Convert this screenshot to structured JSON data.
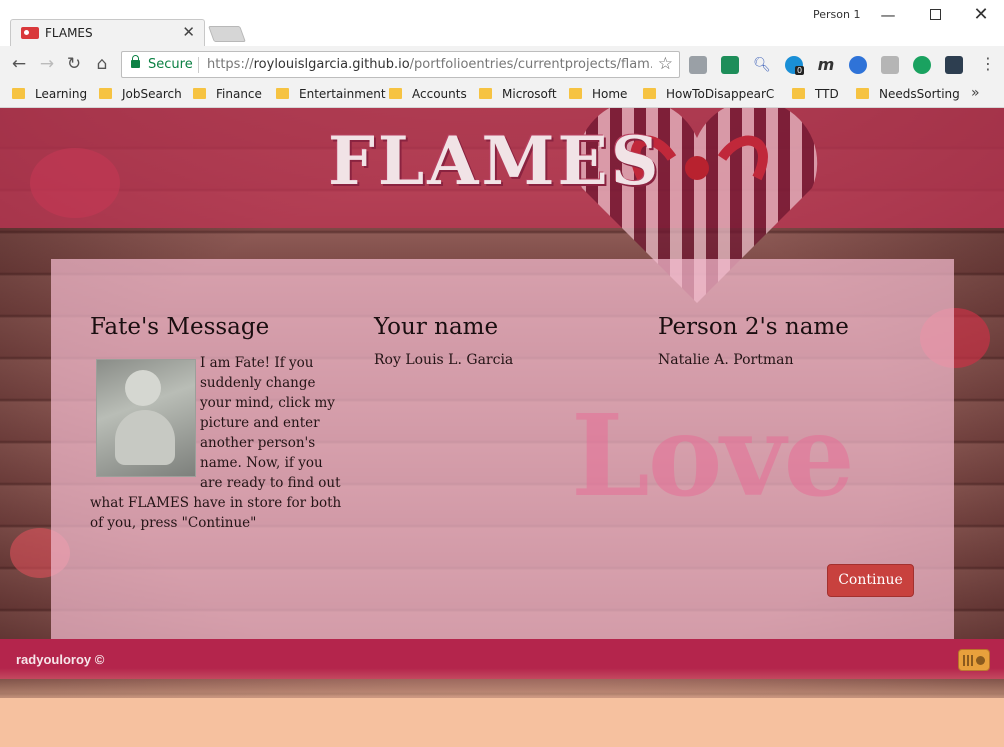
{
  "browser": {
    "tab_title": "FLAMES",
    "profile_label": "Person 1",
    "secure_label": "Secure",
    "url_scheme": "https://",
    "url_host": "roylouislgarcia.github.io",
    "url_path": "/portfolioentries/currentprojects/flam...",
    "extension_badge": "0",
    "bookmarks": [
      "Learning",
      "JobSearch",
      "Finance",
      "Entertainment",
      "Accounts",
      "Microsoft",
      "Home",
      "HowToDisappearCor",
      "TTD",
      "NeedsSorting"
    ]
  },
  "page": {
    "logo": "FLAMES",
    "fate_title": "Fate's Message",
    "fate_message": "I am Fate! If you suddenly change your mind, click my picture and enter another person's name. Now, if you are ready to find out what FLAMES have in store for both of you, press \"Continue\"",
    "your_name_title": "Your name",
    "your_name_value": "Roy Louis L. Garcia",
    "person2_title": "Person 2's name",
    "person2_value": "Natalie A. Portman",
    "continue_label": "Continue",
    "background_word": "Love",
    "footer_text": "radyouloroy ©"
  },
  "colors": {
    "accent": "#c8413e",
    "footer": "#b4254c",
    "header_band": "#c43656",
    "page_bg": "#f6c19f"
  }
}
